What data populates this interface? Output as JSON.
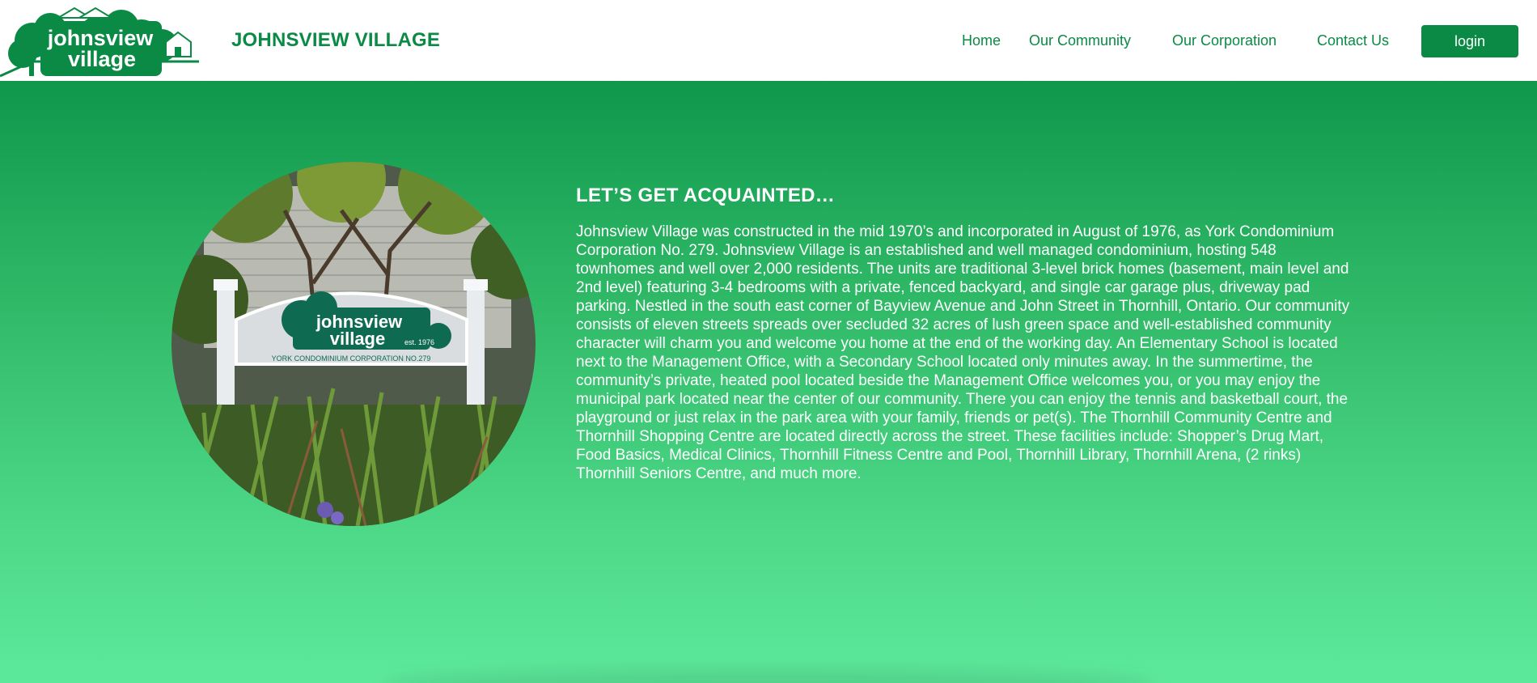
{
  "header": {
    "logo_line1": "johnsview",
    "logo_line2": "village",
    "site_title": "JOHNSVIEW VILLAGE",
    "nav": [
      {
        "label": "Home"
      },
      {
        "label": "Our Community"
      },
      {
        "label": "Our Corporation"
      },
      {
        "label": "Contact Us"
      }
    ],
    "login_label": "login"
  },
  "about": {
    "heading": "LET’S GET ACQUAINTED…",
    "body": "Johnsview Village was constructed in the mid 1970’s and incorporated in August of 1976, as York Condominium Corporation No. 279. Johnsview Village is an established and well managed condominium, hosting 548 townhomes and well over 2,000 residents. The units are traditional 3-level brick homes (basement, main level and 2nd level) featuring 3-4 bedrooms with a private, fenced backyard, and single car garage plus, driveway pad parking. Nestled in the south east corner of Bayview Avenue and John Street in Thornhill, Ontario. Our community consists of eleven streets spreads over secluded 32 acres of lush green space and well-established community character will charm you and welcome you home at the end of the working day. An Elementary School is located next to the Management Office, with a Secondary School located only minutes away. In the summertime, the community’s private, heated pool located beside the Management Office welcomes you, or you may enjoy the municipal park located near the center of our community. There you can enjoy the tennis and basketball court, the playground or just relax in the park area with your family, friends or pet(s). The Thornhill Community Centre and Thornhill Shopping Centre are located directly across the street. These facilities include: Shopper’s Drug Mart, Food Basics, Medical Clinics, Thornhill Fitness Centre and Pool, Thornhill Library, Thornhill Arena, (2 rinks) Thornhill Seniors Centre, and much more."
  },
  "sign_photo": {
    "sign_line1": "johnsview",
    "sign_line2": "village",
    "sign_est": "est. 1976",
    "sign_caption": "YORK CONDOMINIUM CORPORATION NO.279"
  },
  "colors": {
    "brand_green": "#0a8a44",
    "hero_top": "#0f974c",
    "hero_bottom": "#5de99c",
    "text_on_hero": "#ffffff"
  },
  "icons": {
    "logo": "house-and-tree-logo"
  }
}
